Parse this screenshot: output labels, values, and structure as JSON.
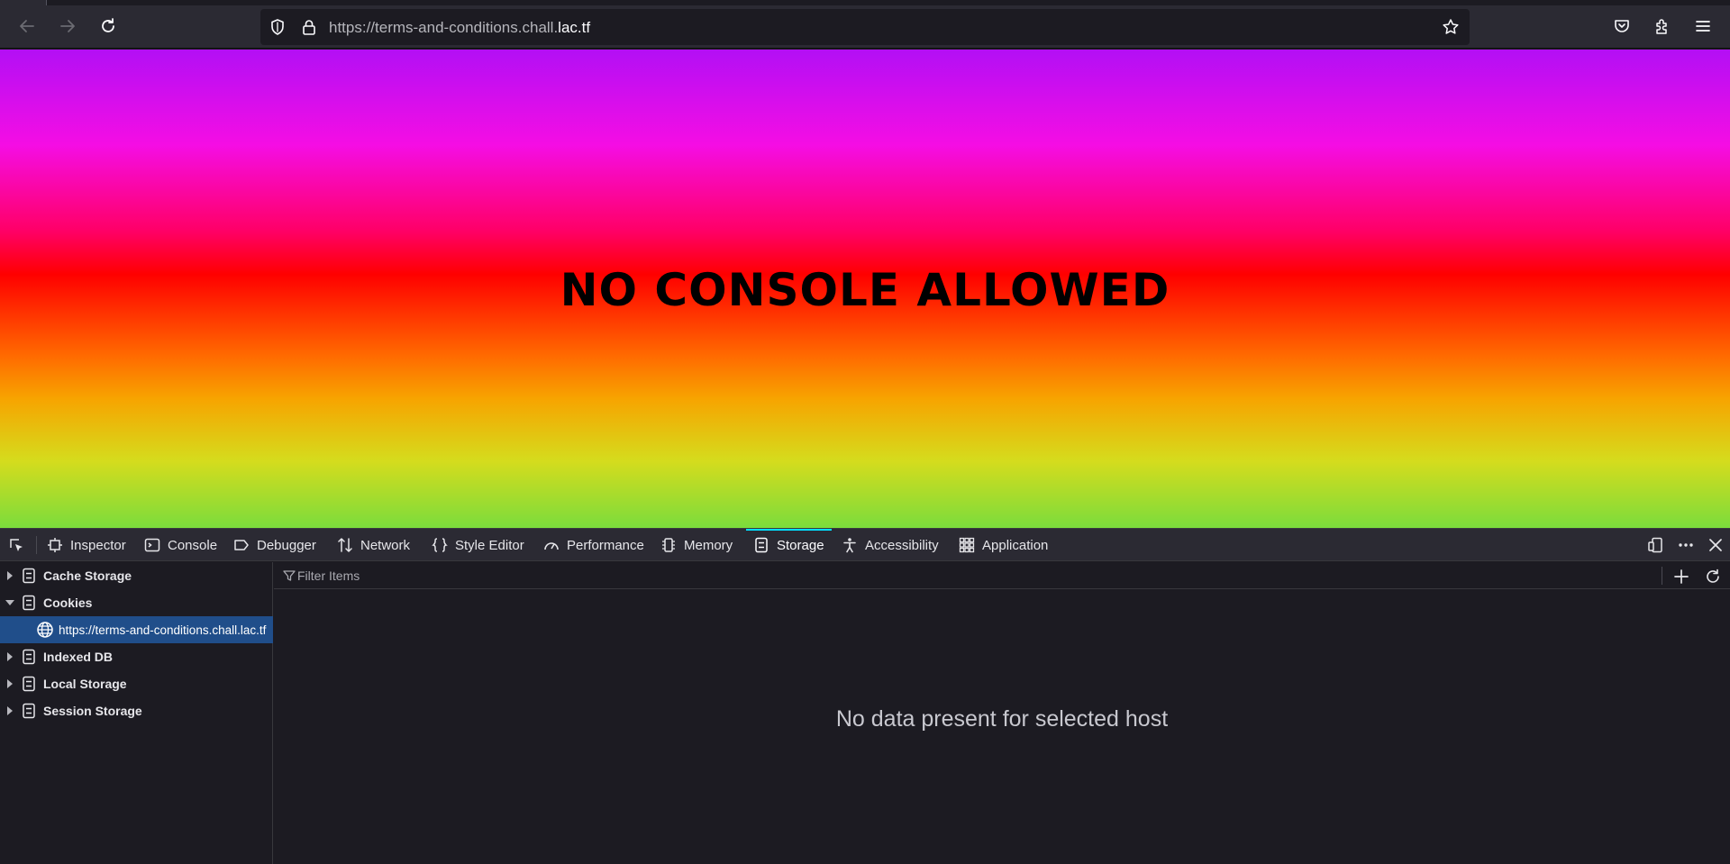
{
  "browser": {
    "url_prefix": "https://terms-and-conditions.chall.",
    "url_domain": "lac.tf",
    "icons": [
      "back-icon",
      "forward-icon",
      "reload-icon",
      "shield-icon",
      "lock-icon",
      "bookmark-star-icon",
      "pocket-icon",
      "extensions-icon",
      "menu-icon"
    ]
  },
  "page": {
    "heading": "NO CONSOLE ALLOWED"
  },
  "devtools": {
    "tabs": {
      "inspector": "Inspector",
      "console": "Console",
      "debugger": "Debugger",
      "network": "Network",
      "style_editor": "Style Editor",
      "performance": "Performance",
      "memory": "Memory",
      "storage": "Storage",
      "accessibility": "Accessibility",
      "application": "Application"
    },
    "active_tab": "Storage",
    "sidebar": {
      "items": [
        {
          "label": "Cache Storage",
          "expanded": false
        },
        {
          "label": "Cookies",
          "expanded": true
        },
        {
          "label": "https://terms-and-conditions.chall.lac.tf",
          "selected": true
        },
        {
          "label": "Indexed DB",
          "expanded": false
        },
        {
          "label": "Local Storage",
          "expanded": false
        },
        {
          "label": "Session Storage",
          "expanded": false
        }
      ]
    },
    "filter": {
      "placeholder": "Filter Items"
    },
    "empty_message": "No data present for selected host",
    "colors": {
      "selected_row": "#204e8a",
      "active_tab_indicator": "#00ddff"
    }
  }
}
